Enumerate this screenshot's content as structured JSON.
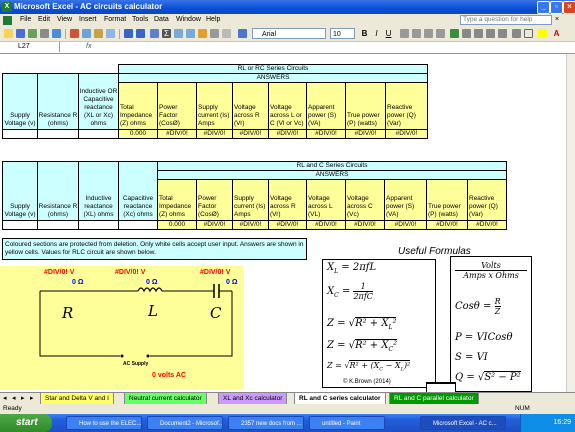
{
  "window": {
    "title": "Microsoft Excel - AC circuits calculator"
  },
  "menu": [
    "File",
    "Edit",
    "View",
    "Insert",
    "Format",
    "Tools",
    "Data",
    "Window",
    "Help"
  ],
  "help_box": {
    "placeholder": "Type a question for help"
  },
  "toolbar": {
    "font": "Arial",
    "size": "10"
  },
  "formula_bar": {
    "name_box": "L27",
    "fx": "fx",
    "value": ""
  },
  "table1": {
    "title": "RL or RC Series Circuits",
    "answers_label": "ANSWERS",
    "inputs": [
      "Supply Voltage (v)",
      "Resistance R (ohms)",
      "Inductive OR Capacitive reactance (XL or Xc) ohms"
    ],
    "answers": [
      "Total Impedance (Z) ohms",
      "Power Factor (CosØ)",
      "Supply current (Is) Amps",
      "Voltage across R (Vr)",
      "Voltage across L or C (Vl or Vc)",
      "Apparent power (S) (VA)",
      "True power (P) (watts)",
      "Reactive power (Q) (Var)"
    ],
    "values": [
      "0.000",
      "#DIV/0!",
      "#DIV/0!",
      "#DIV/0!",
      "#DIV/0!",
      "#DIV/0!",
      "#DIV/0!",
      "#DIV/0!"
    ]
  },
  "table2": {
    "title": "RL and C Series Circuits",
    "answers_label": "ANSWERS",
    "inputs": [
      "Supply Voltage (v)",
      "Resistance R (ohms)",
      "Inductive reactance (XL) ohms",
      "Capacitive reactance (Xc) ohms"
    ],
    "answers": [
      "Total Impedance (Z) ohms",
      "Power Factor (CosØ)",
      "Supply current (Is) Amps",
      "Voltage across R (Vr)",
      "Voltage across L (VL)",
      "Voltage across C (Vc)",
      "Apparent power (S) (VA)",
      "True power (P) (watts)",
      "Reactive power (Q) (Var)"
    ],
    "values": [
      "0.000",
      "#DIV/0!",
      "#DIV/0!",
      "#DIV/0!",
      "#DIV/0!",
      "#DIV/0!",
      "#DIV/0!",
      "#DIV/0!",
      "#DIV/0!"
    ]
  },
  "note": "Coloured sections are protected from deletion. Only white cells accept user input. Answers are shown in yellow cells. Values for RLC circuit are shown below.",
  "circuit": {
    "r_volts": "#DIV/0!",
    "l_volts": "#DIV/0!",
    "c_volts": "#DIV/0!",
    "v_unit": "V",
    "r_ohms": "0",
    "l_ohms": "0",
    "c_ohms": "0",
    "ohm_unit": "Ω",
    "r_label": "R",
    "l_label": "L",
    "c_label": "C",
    "supply_label": "AC Supply",
    "supply_value": "0 volts AC"
  },
  "formulas": {
    "title": "Useful Formulas",
    "copyright": "© K.Brown (2014)"
  },
  "sheet_tabs": [
    "Star and Delta V and I",
    "Neutral current calculator",
    "XL and Xc calculator",
    "RL and C series calculator",
    "RL and C parallel calculator"
  ],
  "status": {
    "left": "Ready",
    "right": "NUM"
  },
  "taskbar": {
    "start": "start",
    "tasks": [
      "How to use the ELEC...",
      "Document2 - Microsof...",
      "2357 new docs from ...",
      "untitled - Paint",
      "Microsoft Excel - AC c..."
    ],
    "clock": "16:29"
  },
  "colors": {
    "protected": "#ccffff",
    "answers": "#ffff99",
    "error_red": "#ff0000",
    "ohm_blue": "#0000ff"
  }
}
